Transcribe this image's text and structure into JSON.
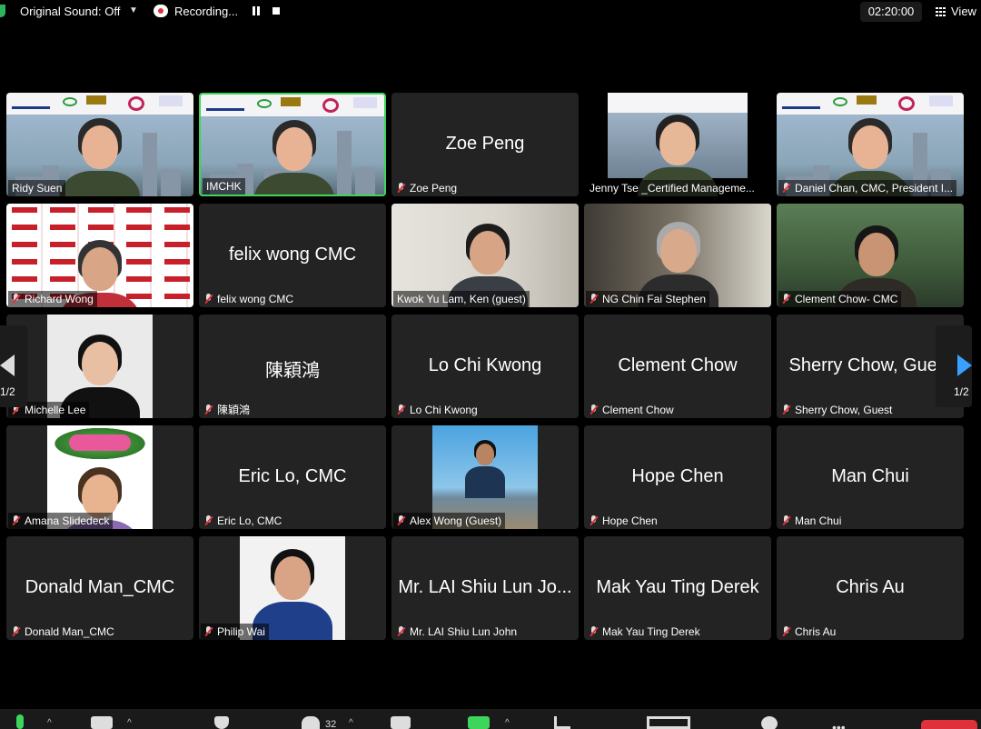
{
  "topbar": {
    "original_sound": "Original Sound: Off",
    "recording": "Recording...",
    "timer": "02:20:00",
    "view": "View"
  },
  "tiles": [
    {
      "display": "",
      "name": "Ridy Suen",
      "muted": false,
      "video": "imchk-banner"
    },
    {
      "display": "",
      "name": "IMCHK",
      "muted": false,
      "video": "imchk-banner",
      "active": true
    },
    {
      "display": "Zoe Peng",
      "name": "Zoe Peng",
      "muted": true
    },
    {
      "display": "",
      "name": "Jenny Tse _Certified Manageme...",
      "muted": false,
      "video": "slide"
    },
    {
      "display": "",
      "name": "Daniel Chan, CMC, President I...",
      "muted": true,
      "video": "imchk-banner"
    },
    {
      "display": "",
      "name": "Richard Wong",
      "muted": true,
      "video": "pattern"
    },
    {
      "display": "felix wong CMC",
      "name": "felix wong CMC",
      "muted": true
    },
    {
      "display": "",
      "name": "Kwok Yu Lam, Ken (guest)",
      "muted": false,
      "video": "room"
    },
    {
      "display": "",
      "name": "NG Chin Fai Stephen",
      "muted": true,
      "video": "bookshelf"
    },
    {
      "display": "",
      "name": "Clement Chow- CMC",
      "muted": true,
      "video": "outdoor"
    },
    {
      "display": "",
      "name": "Michelle Lee",
      "muted": true,
      "video": "portrait"
    },
    {
      "display": "陳穎鴻",
      "name": "陳穎鴻",
      "muted": true
    },
    {
      "display": "Lo Chi Kwong",
      "name": "Lo Chi Kwong",
      "muted": true
    },
    {
      "display": "Clement Chow",
      "name": "Clement Chow",
      "muted": true
    },
    {
      "display": "Sherry Chow, Guest",
      "name": "Sherry Chow, Guest",
      "muted": true
    },
    {
      "display": "",
      "name": "Amana Slidedeck",
      "muted": true,
      "video": "aloha"
    },
    {
      "display": "Eric Lo, CMC",
      "name": "Eric Lo, CMC",
      "muted": true
    },
    {
      "display": "",
      "name": "Alex Wong (Guest)",
      "muted": true,
      "video": "mountain"
    },
    {
      "display": "Hope Chen",
      "name": "Hope Chen",
      "muted": true
    },
    {
      "display": "Man Chui",
      "name": "Man Chui",
      "muted": true
    },
    {
      "display": "Donald Man_CMC",
      "name": "Donald Man_CMC",
      "muted": true
    },
    {
      "display": "",
      "name": "Philip Wai",
      "muted": true,
      "video": "photo"
    },
    {
      "display": "Mr. LAI Shiu Lun Jo...",
      "name": "Mr. LAI Shiu Lun John",
      "muted": true
    },
    {
      "display": "Mak Yau Ting Derek",
      "name": "Mak Yau Ting Derek",
      "muted": true
    },
    {
      "display": "Chris Au",
      "name": "Chris Au",
      "muted": true
    }
  ],
  "nav": {
    "left_page": "1/2",
    "right_page": "1/2"
  },
  "toolbar": {
    "participants_count": "32"
  },
  "colors": {
    "active_border": "#3bd65b",
    "muted_icon": "#e0313a",
    "tile_bg": "#232323"
  }
}
